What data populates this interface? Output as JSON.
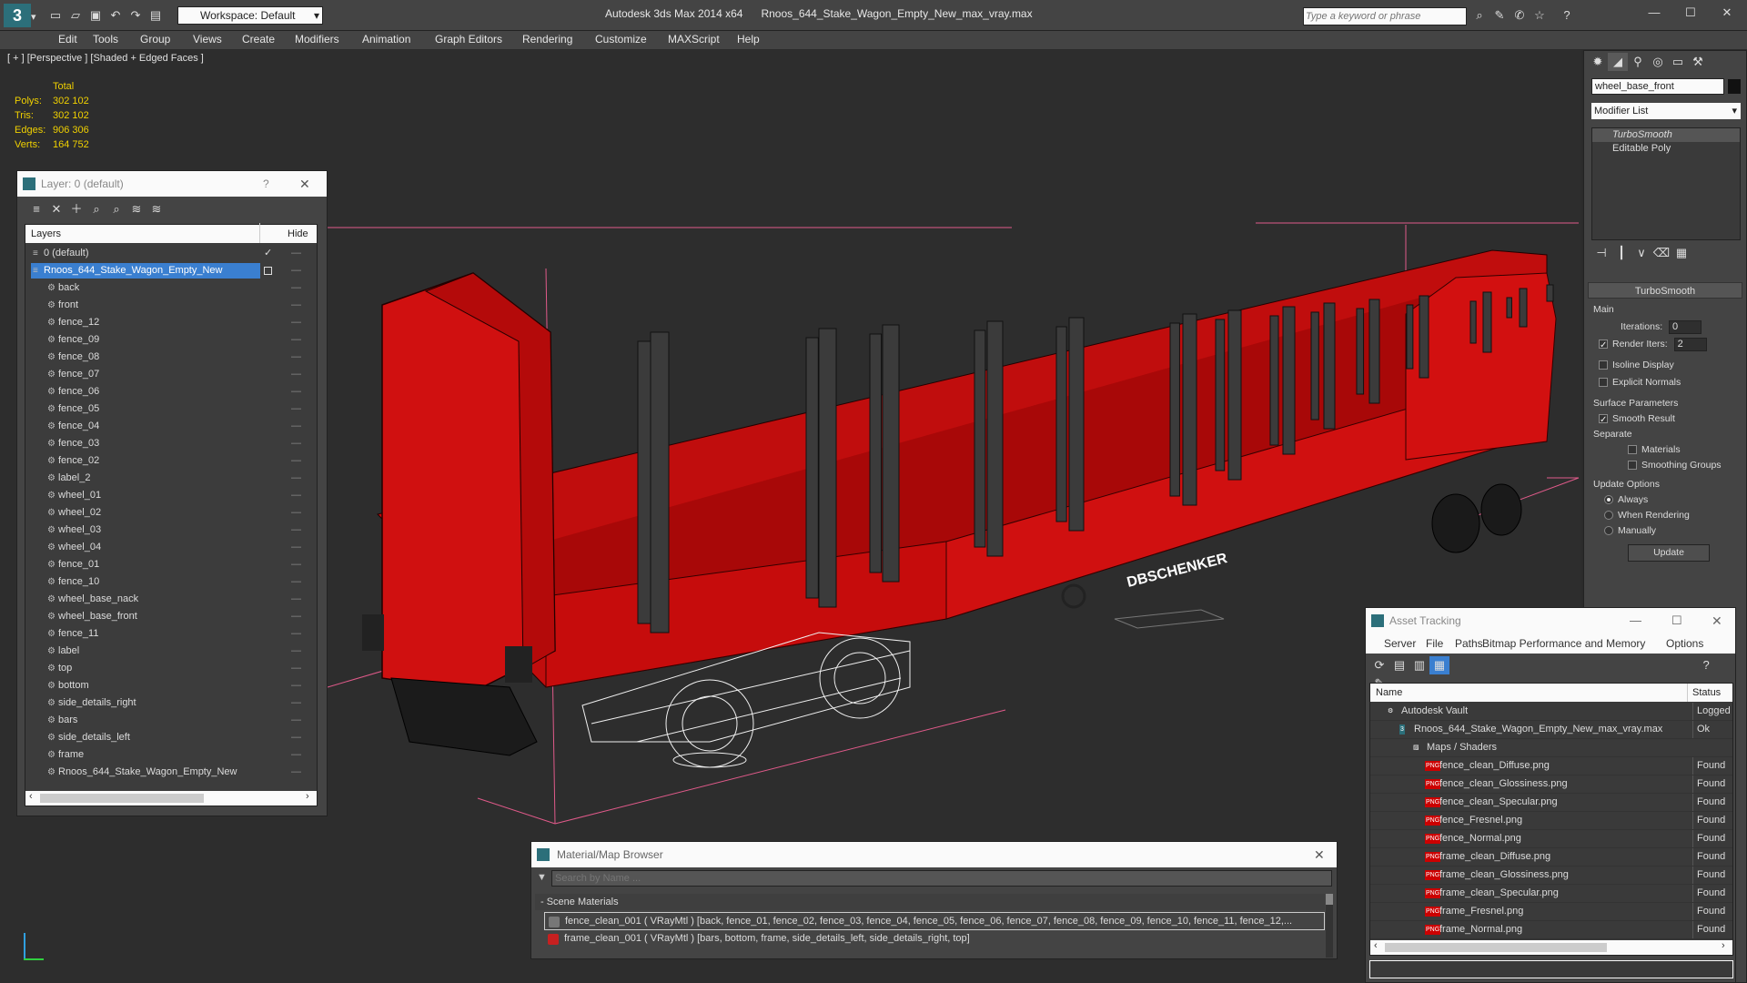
{
  "app": {
    "title": "Autodesk 3ds Max  2014 x64",
    "filename": "Rnoos_644_Stake_Wagon_Empty_New_max_vray.max",
    "workspace": "Workspace: Default",
    "search_placeholder": "Type a keyword or phrase"
  },
  "menu": [
    "Edit",
    "Tools",
    "Group",
    "Views",
    "Create",
    "Modifiers",
    "Animation",
    "Graph Editors",
    "Rendering",
    "Customize",
    "MAXScript",
    "Help"
  ],
  "viewport": {
    "label": "[ + ] [Perspective ] [Shaded + Edged Faces ]",
    "stats": {
      "header": "Total",
      "rows": [
        {
          "k": "Polys:",
          "v": "302 102"
        },
        {
          "k": "Tris:",
          "v": "302 102"
        },
        {
          "k": "Edges:",
          "v": "906 306"
        },
        {
          "k": "Verts:",
          "v": "164 752"
        }
      ]
    },
    "logo_text": "DBSCHENKER"
  },
  "layers": {
    "title": "Layer: 0 (default)",
    "help": "?",
    "col_layers": "Layers",
    "col_hide": "Hide",
    "items": [
      {
        "name": "0 (default)",
        "level": 0,
        "check": "✓"
      },
      {
        "name": "Rnoos_644_Stake_Wagon_Empty_New",
        "level": 0,
        "selected": true
      },
      {
        "name": "back",
        "level": 1
      },
      {
        "name": "front",
        "level": 1
      },
      {
        "name": "fence_12",
        "level": 1
      },
      {
        "name": "fence_09",
        "level": 1
      },
      {
        "name": "fence_08",
        "level": 1
      },
      {
        "name": "fence_07",
        "level": 1
      },
      {
        "name": "fence_06",
        "level": 1
      },
      {
        "name": "fence_05",
        "level": 1
      },
      {
        "name": "fence_04",
        "level": 1
      },
      {
        "name": "fence_03",
        "level": 1
      },
      {
        "name": "fence_02",
        "level": 1
      },
      {
        "name": "label_2",
        "level": 1
      },
      {
        "name": "wheel_01",
        "level": 1
      },
      {
        "name": "wheel_02",
        "level": 1
      },
      {
        "name": "wheel_03",
        "level": 1
      },
      {
        "name": "wheel_04",
        "level": 1
      },
      {
        "name": "fence_01",
        "level": 1
      },
      {
        "name": "fence_10",
        "level": 1
      },
      {
        "name": "wheel_base_nack",
        "level": 1
      },
      {
        "name": "wheel_base_front",
        "level": 1
      },
      {
        "name": "fence_11",
        "level": 1
      },
      {
        "name": "label",
        "level": 1
      },
      {
        "name": "top",
        "level": 1
      },
      {
        "name": "bottom",
        "level": 1
      },
      {
        "name": "side_details_right",
        "level": 1
      },
      {
        "name": "bars",
        "level": 1
      },
      {
        "name": "side_details_left",
        "level": 1
      },
      {
        "name": "frame",
        "level": 1
      },
      {
        "name": "Rnoos_644_Stake_Wagon_Empty_New",
        "level": 1
      }
    ]
  },
  "cmd": {
    "object_name": "wheel_base_front",
    "modifier_list": "Modifier List",
    "stack": [
      "TurboSmooth",
      "Editable Poly"
    ],
    "rollout_title": "TurboSmooth",
    "main": "Main",
    "iterations_label": "Iterations:",
    "iterations": "0",
    "render_iters_label": "Render Iters:",
    "render_iters": "2",
    "isoline": "Isoline Display",
    "explicit": "Explicit Normals",
    "surface": "Surface Parameters",
    "smooth_result": "Smooth Result",
    "separate": "Separate",
    "materials": "Materials",
    "smoothing": "Smoothing Groups",
    "update_options": "Update Options",
    "always": "Always",
    "when_rendering": "When Rendering",
    "manually": "Manually",
    "update": "Update"
  },
  "asset": {
    "title": "Asset Tracking",
    "menu": [
      "Server",
      "File",
      "Paths",
      "Bitmap Performance and Memory",
      "Options"
    ],
    "col_name": "Name",
    "col_status": "Status",
    "rows": [
      {
        "name": "Autodesk Vault",
        "status": "Logged C",
        "level": 0
      },
      {
        "name": "Rnoos_644_Stake_Wagon_Empty_New_max_vray.max",
        "status": "Ok",
        "level": 1
      },
      {
        "name": "Maps / Shaders",
        "status": "",
        "level": 2
      },
      {
        "name": "fence_clean_Diffuse.png",
        "status": "Found",
        "level": 3
      },
      {
        "name": "fence_clean_Glossiness.png",
        "status": "Found",
        "level": 3
      },
      {
        "name": "fence_clean_Specular.png",
        "status": "Found",
        "level": 3
      },
      {
        "name": "fence_Fresnel.png",
        "status": "Found",
        "level": 3
      },
      {
        "name": "fence_Normal.png",
        "status": "Found",
        "level": 3
      },
      {
        "name": "frame_clean_Diffuse.png",
        "status": "Found",
        "level": 3
      },
      {
        "name": "frame_clean_Glossiness.png",
        "status": "Found",
        "level": 3
      },
      {
        "name": "frame_clean_Specular.png",
        "status": "Found",
        "level": 3
      },
      {
        "name": "frame_Fresnel.png",
        "status": "Found",
        "level": 3
      },
      {
        "name": "frame_Normal.png",
        "status": "Found",
        "level": 3
      }
    ]
  },
  "matbrowser": {
    "title": "Material/Map Browser",
    "search_placeholder": "Search by Name ...",
    "section": "- Scene Materials",
    "rows": [
      "fence_clean_001  ( VRayMtl )  [back, fence_01, fence_02, fence_03, fence_04, fence_05, fence_06, fence_07, fence_08, fence_09, fence_10, fence_11, fence_12,...",
      "frame_clean_001  ( VRayMtl )  [bars, bottom, frame, side_details_left, side_details_right, top]"
    ]
  },
  "colors": {
    "accent": "#3a7fd0",
    "wagon_red": "#d01010",
    "selection": "#3a7fd0",
    "bbox": "#e05a8a"
  }
}
